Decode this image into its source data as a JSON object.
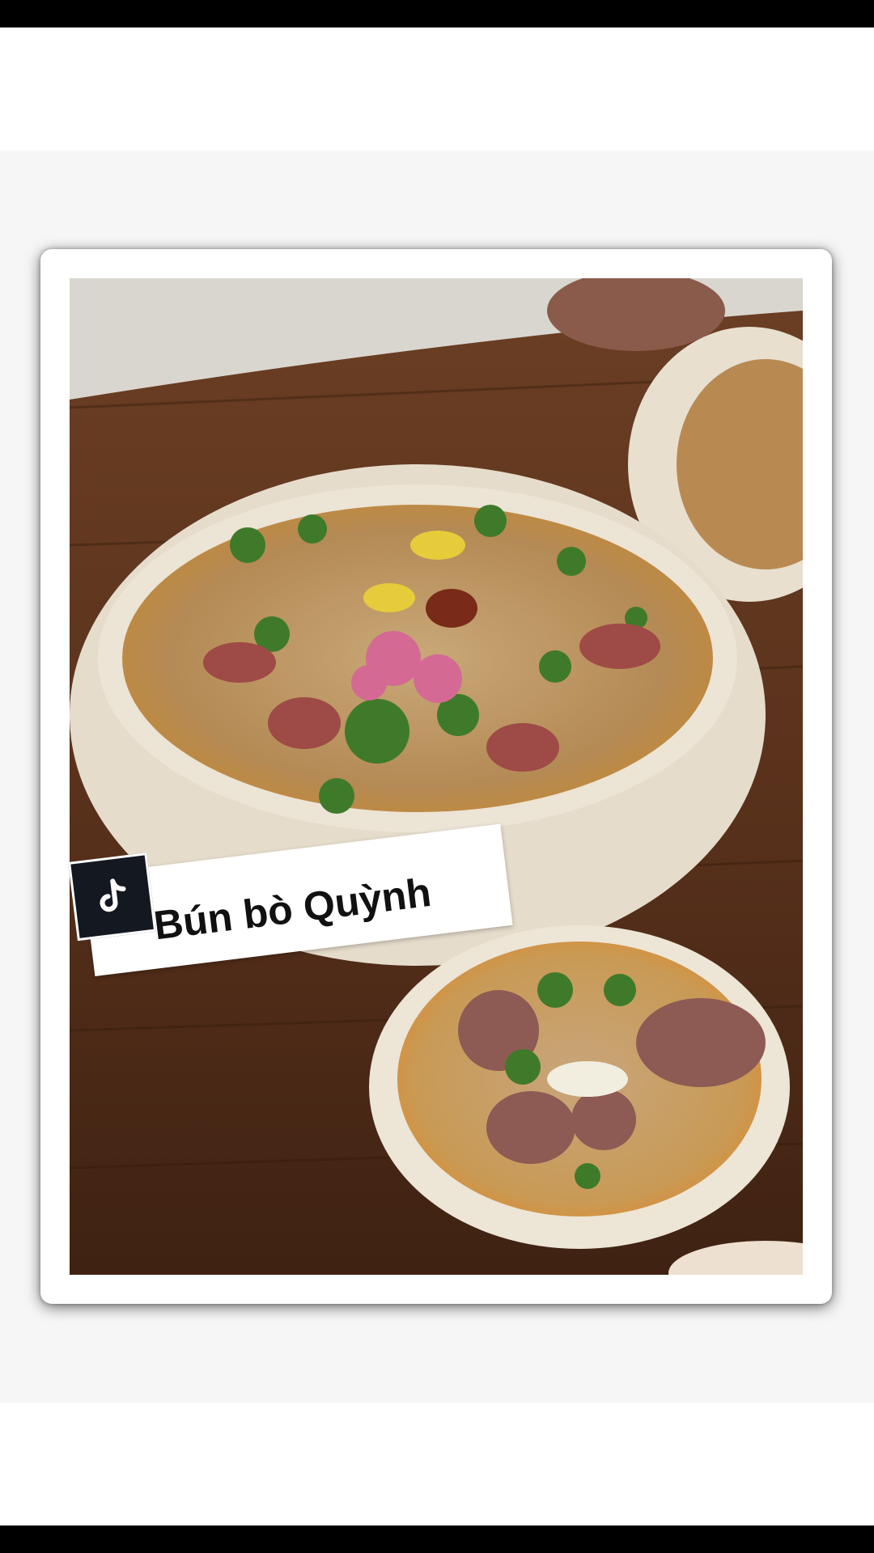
{
  "overlay": {
    "caption": "Bún bò Quỳnh",
    "badge_icon": "tiktok-logo-icon"
  },
  "colors": {
    "system_bar": "#000000",
    "frame": "#ffffff",
    "caption_text": "#111111",
    "badge_background": "#141820"
  },
  "photo": {
    "icon": "food-photo"
  }
}
